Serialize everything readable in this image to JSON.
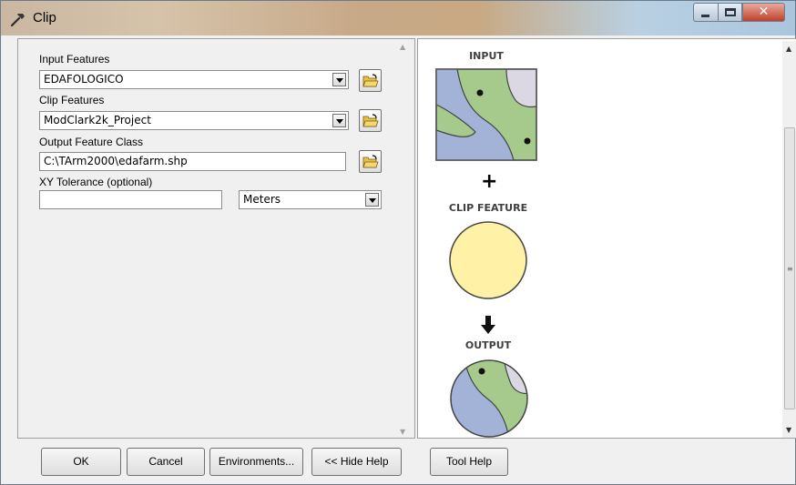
{
  "window": {
    "title": "Clip"
  },
  "form": {
    "input_features": {
      "label": "Input Features",
      "value": "EDAFOLOGICO"
    },
    "clip_features": {
      "label": "Clip Features",
      "value": "ModClark2k_Project"
    },
    "output_feature_class": {
      "label": "Output Feature Class",
      "value": "C:\\TArm2000\\edafarm.shp"
    },
    "xy_tolerance": {
      "label": "XY Tolerance (optional)",
      "value": "",
      "unit": "Meters"
    }
  },
  "help": {
    "input_caption": "INPUT",
    "plus_symbol": "+",
    "clip_caption": "CLIP FEATURE",
    "output_caption": "OUTPUT"
  },
  "buttons": {
    "ok": "OK",
    "cancel": "Cancel",
    "environments": "Environments...",
    "hide_help": "<< Hide Help",
    "tool_help": "Tool Help"
  },
  "icons": {
    "title": "hammer-icon",
    "browse": "open-folder-icon",
    "dropdown": "chevron-down-icon"
  },
  "colors": {
    "map_green": "#a6c98c",
    "map_blue": "#a3b3d8",
    "map_lavender": "#dcd8e3",
    "clip_yellow": "#fff2a6"
  }
}
